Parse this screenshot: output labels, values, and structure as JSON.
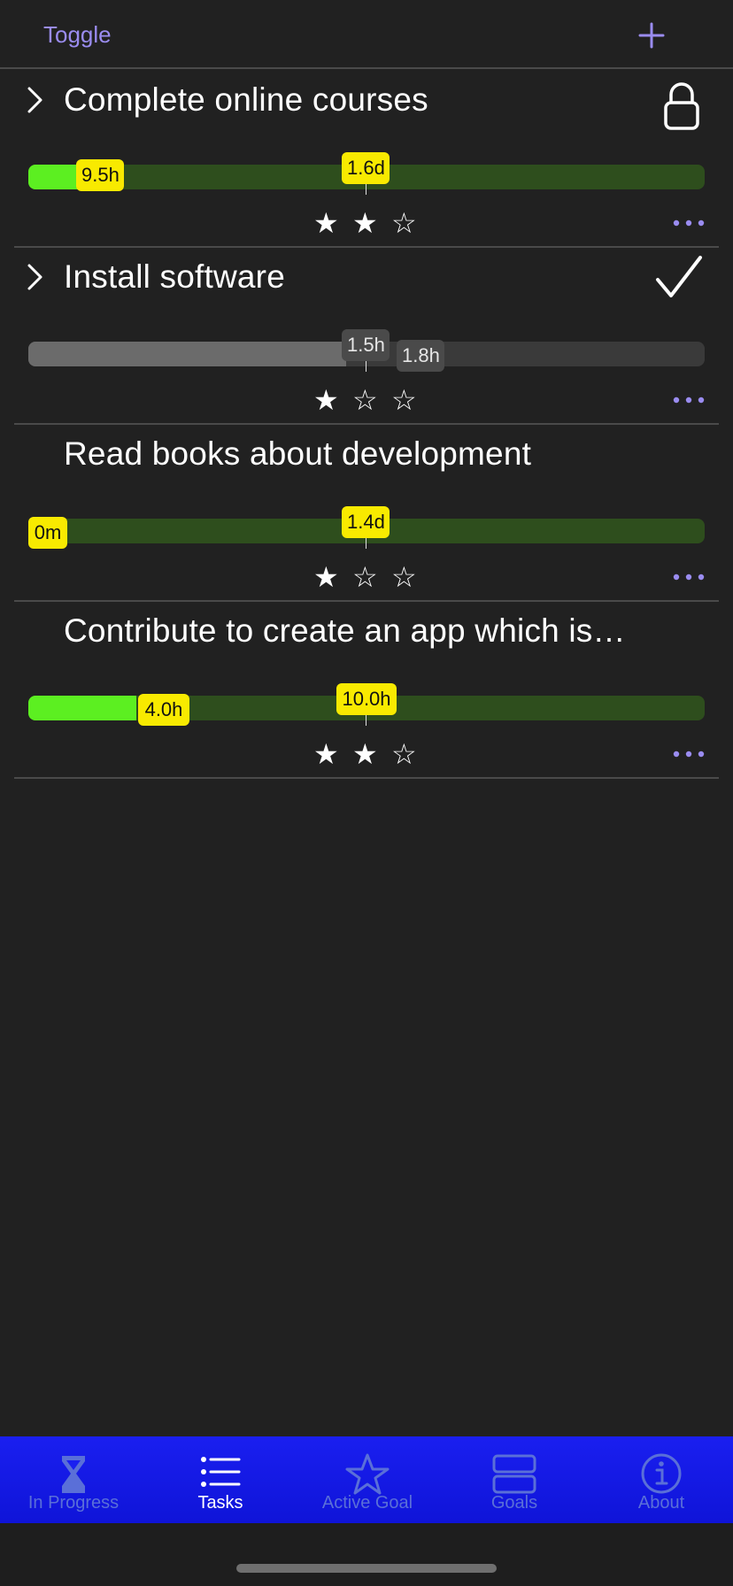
{
  "nav": {
    "toggle_label": "Toggle",
    "add_icon": "plus-icon"
  },
  "colors": {
    "accent": "#9a8cf0",
    "progress_bright": "#5cef21",
    "progress_dark": "#2e4e1d",
    "tag_yellow": "#f8ea00",
    "tabbar_blue": "#1a1ff0"
  },
  "tasks": [
    {
      "title": "Complete online courses",
      "expandable": true,
      "status_icon": "lock-icon",
      "progress_percent": 8.5,
      "elapsed_label": "9.5h",
      "target_label": "1.6d",
      "rating": 2,
      "max_rating": 3
    },
    {
      "title": "Install software",
      "expandable": true,
      "status_icon": "checkmark-icon",
      "progress_percent": 47,
      "elapsed_label": "1.8h",
      "target_label": "1.5h",
      "rating": 1,
      "max_rating": 3
    },
    {
      "title": "Read books about development",
      "expandable": false,
      "status_icon": "",
      "progress_percent": 0,
      "elapsed_label": "0m",
      "target_label": "1.4d",
      "rating": 1,
      "max_rating": 3
    },
    {
      "title": "Contribute to create an app which is…",
      "expandable": false,
      "status_icon": "",
      "progress_percent": 16,
      "elapsed_label": "4.0h",
      "target_label": "10.0h",
      "rating": 2,
      "max_rating": 3
    }
  ],
  "tabbar": {
    "items": [
      {
        "label": "In Progress",
        "icon": "hourglass-icon",
        "active": false
      },
      {
        "label": "Tasks",
        "icon": "list-icon",
        "active": true
      },
      {
        "label": "Active Goal",
        "icon": "star-icon",
        "active": false
      },
      {
        "label": "Goals",
        "icon": "stack-icon",
        "active": false
      },
      {
        "label": "About",
        "icon": "info-icon",
        "active": false
      }
    ]
  }
}
